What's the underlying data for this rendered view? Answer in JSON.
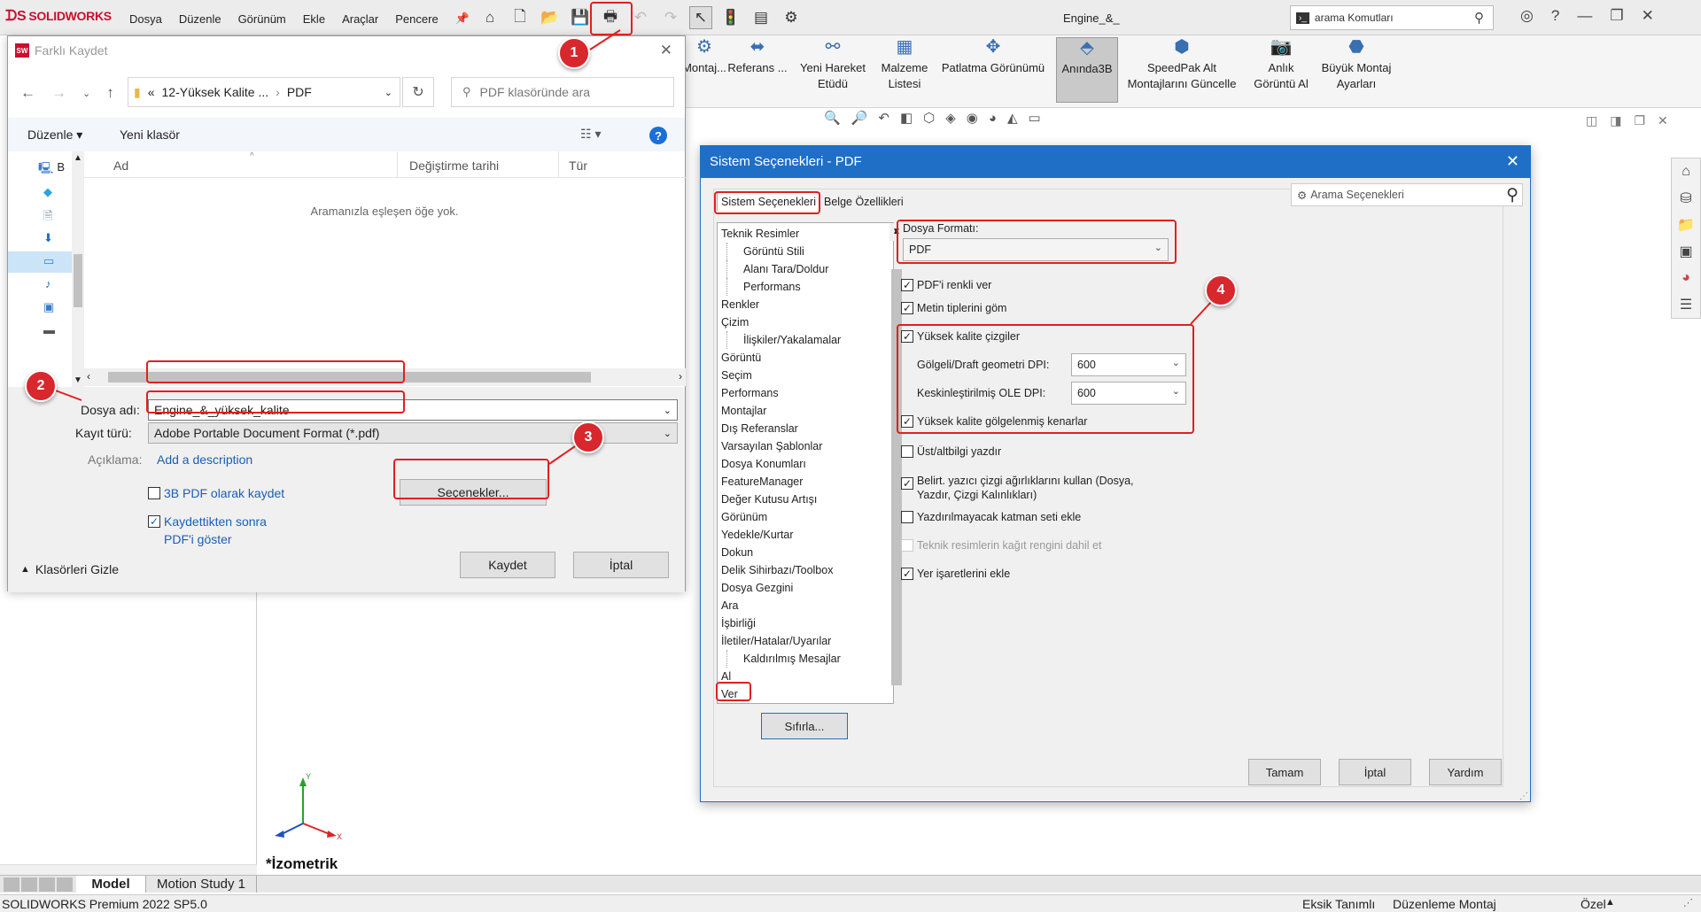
{
  "app": {
    "logo": "SOLIDWORKS",
    "menus": [
      "Dosya",
      "Düzenle",
      "Görünüm",
      "Ekle",
      "Araçlar",
      "Pencere"
    ],
    "doc_title": "Engine_&_",
    "search_placeholder": "arama Komutları"
  },
  "ribbon": {
    "items": [
      {
        "label1": "Montaj..."
      },
      {
        "label1": "Referans ..."
      },
      {
        "label1": "Yeni Hareket",
        "label2": "Etüdü"
      },
      {
        "label1": "Malzeme",
        "label2": "Listesi"
      },
      {
        "label1": "Patlatma Görünümü"
      },
      {
        "label1": "Anında3B"
      },
      {
        "label1": "SpeedPak Alt",
        "label2": "Montajlarını Güncelle"
      },
      {
        "label1": "Anlık",
        "label2": "Görüntü Al"
      },
      {
        "label1": "Büyük Montaj",
        "label2": "Ayarları"
      }
    ]
  },
  "save_dialog": {
    "title": "Farklı Kaydet",
    "address": [
      "«",
      "12-Yüksek Kalite ...",
      "›",
      "PDF"
    ],
    "search_placeholder": "PDF klasöründe ara",
    "organize": "Düzenle",
    "new_folder": "Yeni klasör",
    "columns": [
      "Ad",
      "Değiştirme tarihi",
      "Tür"
    ],
    "empty_message": "Aramanızla eşleşen öğe yok.",
    "file_name_label": "Dosya adı:",
    "file_name": "Engine_&_yüksek_kalite",
    "save_type_label": "Kayıt türü:",
    "save_type": "Adobe Portable Document Format (*.pdf)",
    "description_label": "Açıklama:",
    "description_link": "Add a description",
    "save_3d_pdf": "3B PDF olarak kaydet",
    "show_after_1": "Kaydettikten sonra",
    "show_after_2": "PDF'i göster",
    "options_button": "Seçenekler...",
    "hide_folders": "Klasörleri Gizle",
    "save_button": "Kaydet",
    "cancel_button": "İptal",
    "nav_label_b": "B"
  },
  "sys_dialog": {
    "title": "Sistem Seçenekleri - PDF",
    "tab_system": "Sistem Seçenekleri",
    "tab_document": "Belge Özellikleri",
    "search_placeholder": "Arama Seçenekleri",
    "tree": [
      {
        "label": "Teknik Resimler",
        "indent": 0
      },
      {
        "label": "Görüntü Stili",
        "indent": 1
      },
      {
        "label": "Alanı Tara/Doldur",
        "indent": 1
      },
      {
        "label": "Performans",
        "indent": 1
      },
      {
        "label": "Renkler",
        "indent": 0
      },
      {
        "label": "Çizim",
        "indent": 0
      },
      {
        "label": "İlişkiler/Yakalamalar",
        "indent": 1
      },
      {
        "label": "Görüntü",
        "indent": 0
      },
      {
        "label": "Seçim",
        "indent": 0
      },
      {
        "label": "Performans",
        "indent": 0
      },
      {
        "label": "Montajlar",
        "indent": 0
      },
      {
        "label": "Dış Referanslar",
        "indent": 0
      },
      {
        "label": "Varsayılan Şablonlar",
        "indent": 0
      },
      {
        "label": "Dosya Konumları",
        "indent": 0
      },
      {
        "label": "FeatureManager",
        "indent": 0
      },
      {
        "label": "Değer Kutusu Artışı",
        "indent": 0
      },
      {
        "label": "Görünüm",
        "indent": 0
      },
      {
        "label": "Yedekle/Kurtar",
        "indent": 0
      },
      {
        "label": "Dokun",
        "indent": 0
      },
      {
        "label": "Delik Sihirbazı/Toolbox",
        "indent": 0
      },
      {
        "label": "Dosya Gezgini",
        "indent": 0
      },
      {
        "label": "Ara",
        "indent": 0
      },
      {
        "label": "İşbirliği",
        "indent": 0
      },
      {
        "label": "İletiler/Hatalar/Uyarılar",
        "indent": 0
      },
      {
        "label": "Kaldırılmış Mesajlar",
        "indent": 1
      },
      {
        "label": "Al",
        "indent": 0
      },
      {
        "label": "Ver",
        "indent": 0
      }
    ],
    "reset_button": "Sıfırla...",
    "file_format_label": "Dosya Formatı:",
    "file_format": "PDF",
    "opt_color": "PDF'i renkli ver",
    "opt_embed_fonts": "Metin tiplerini göm",
    "opt_hq_lines": "Yüksek kalite çizgiler",
    "dpi_shaded_label": "Gölgeli/Draft geometri DPI:",
    "dpi_shaded": "600",
    "dpi_ole_label": "Keskinleştirilmiş OLE DPI:",
    "dpi_ole": "600",
    "opt_hq_edges": "Yüksek kalite gölgelenmiş kenarlar",
    "opt_header_footer": "Üst/altbilgi yazdır",
    "opt_line_weights_1": "Belirt. yazıcı çizgi ağırlıklarını kullan (Dosya,",
    "opt_line_weights_2": "Yazdır, Çizgi Kalınlıkları)",
    "opt_noprint_layer": "Yazdırılmayacak katman seti ekle",
    "opt_paper_color": "Teknik resimlerin kağıt rengini dahil et",
    "opt_bookmarks": "Yer işaretlerini ekle",
    "ok_button": "Tamam",
    "cancel_button": "İptal",
    "help_button": "Yardım"
  },
  "markers": [
    "1",
    "2",
    "3",
    "4"
  ],
  "viewport": {
    "view_label": "*İzometrik"
  },
  "bottom_tabs": [
    "Model",
    "Motion Study 1"
  ],
  "status": {
    "version": "SOLIDWORKS Premium 2022 SP5.0",
    "underdefined": "Eksik Tanımlı",
    "editing": "Düzenleme Montaj",
    "units": "Özel"
  },
  "colors": {
    "accent": "#1f6fc7",
    "highlight": "#e02020",
    "marker": "#d7282d",
    "link": "#1a5fb4"
  }
}
